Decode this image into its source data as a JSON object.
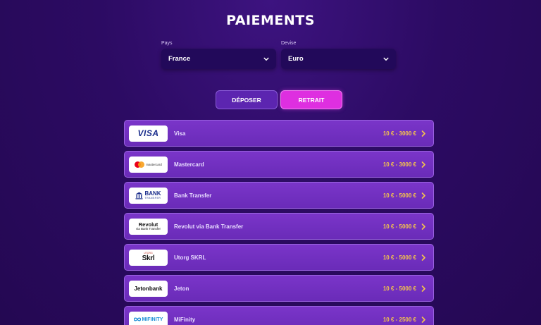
{
  "header": {
    "title": "PAIEMENTS"
  },
  "filters": {
    "country": {
      "label": "Pays",
      "value": "France"
    },
    "currency": {
      "label": "Devise",
      "value": "Euro"
    }
  },
  "tabs": [
    {
      "label": "DÉPOSER",
      "active": false
    },
    {
      "label": "RETRAIT",
      "active": true
    }
  ],
  "methods": [
    {
      "logo_text": "VISA",
      "name": "Visa",
      "range": "10 € - 3000 €",
      "icon": "visa-logo"
    },
    {
      "logo_text": "mastercard",
      "name": "Mastercard",
      "range": "10 € - 3000 €",
      "icon": "mastercard-logo"
    },
    {
      "logo_text": "BANK",
      "logo_sub": "TRANSFER",
      "name": "Bank Transfer",
      "range": "10 € - 5000 €",
      "icon": "bank-transfer-logo"
    },
    {
      "logo_text": "Revolut",
      "logo_sub": "via Bank Transfer",
      "name": "Revolut via Bank Transfer",
      "range": "10 € - 5000 €",
      "icon": "revolut-logo"
    },
    {
      "logo_text": "Skrl",
      "logo_sub": "UTORG",
      "name": "Utorg SKRL",
      "range": "10 € - 5000 €",
      "icon": "skrl-logo"
    },
    {
      "logo_text": "Jetonbank",
      "name": "Jeton",
      "range": "10 € - 5000 €",
      "icon": "jetonbank-logo"
    },
    {
      "logo_text": "MIFINITY",
      "name": "MiFinity",
      "range": "10 € - 2500 €",
      "icon": "mifinity-logo"
    }
  ],
  "colors": {
    "background": "#2c0b63",
    "row": "#7a35c9",
    "range_text": "#f6c64a",
    "active_tab": "#de2fe0",
    "inactive_tab": "#5c25b0"
  }
}
